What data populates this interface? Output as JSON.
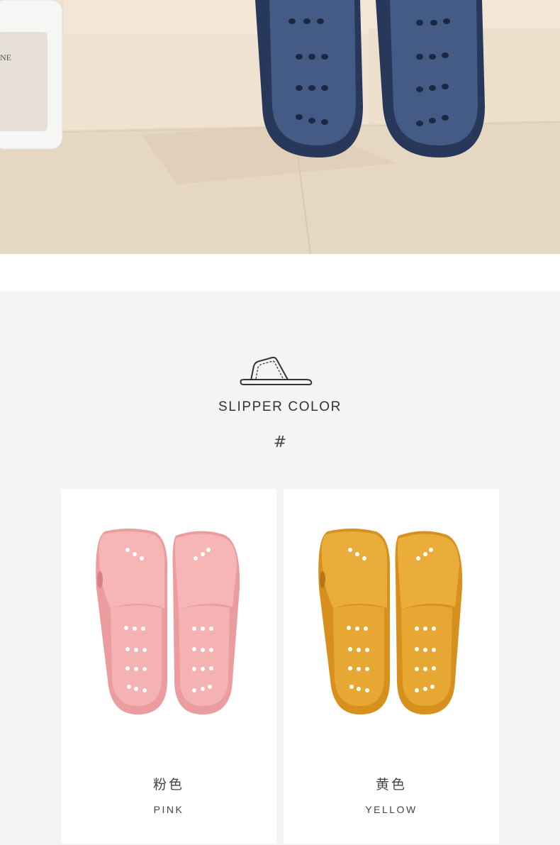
{
  "hero": {
    "bottle_label": "NE",
    "colors": {
      "wall": "#efe3d2",
      "floor": "#e4d4bf",
      "slipper": "#3f5278"
    }
  },
  "section": {
    "icon": "slipper-icon",
    "title": "SLIPPER COLOR",
    "symbol": "#"
  },
  "products": [
    {
      "name_cn": "粉色",
      "name_en": "PINK",
      "color": "#f0a7a8",
      "icon": "pink-slippers-image"
    },
    {
      "name_cn": "黄色",
      "name_en": "YELLOW",
      "color": "#e6a42e",
      "icon": "yellow-slippers-image"
    }
  ]
}
